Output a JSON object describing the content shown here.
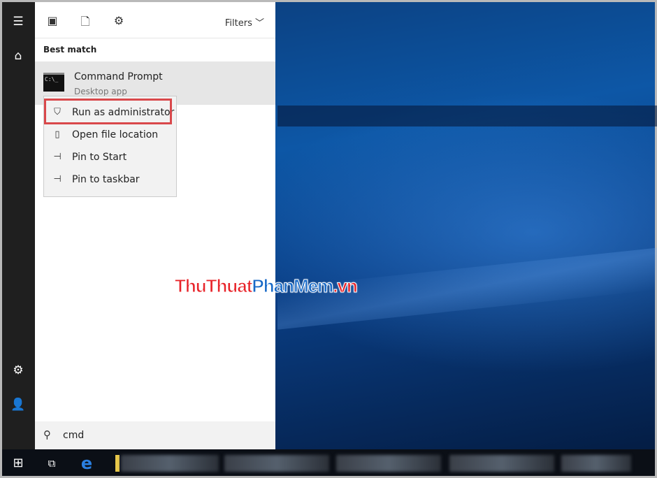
{
  "rail": {
    "icons": [
      "hamburger-menu-icon",
      "home-icon",
      "settings-icon",
      "user-icon"
    ]
  },
  "toolbar": {
    "icons": [
      "apps-icon",
      "documents-icon",
      "settings-icon"
    ],
    "filters_label": "Filters"
  },
  "results": {
    "section_title": "Best match",
    "item": {
      "title": "Command Prompt",
      "subtitle": "Desktop app",
      "icon": "command-prompt-icon",
      "icon_text": "C:\\_"
    }
  },
  "context_menu": {
    "items": [
      {
        "label": "Run as administrator",
        "icon": "shield-window-icon",
        "highlighted": true
      },
      {
        "label": "Open file location",
        "icon": "folder-open-icon"
      },
      {
        "label": "Pin to Start",
        "icon": "pin-icon"
      },
      {
        "label": "Pin to taskbar",
        "icon": "pin-icon"
      }
    ],
    "highlight_color": "#d9484b"
  },
  "search": {
    "value": "cmd",
    "icon": "search-icon"
  },
  "taskbar": {
    "icons": [
      "windows-start-icon",
      "task-view-icon",
      "edge-icon",
      "file-explorer-icon"
    ]
  },
  "watermark": {
    "text_red": "ThuThuat",
    "text_blue": "PhanMem",
    "text_red2": ".vn"
  }
}
